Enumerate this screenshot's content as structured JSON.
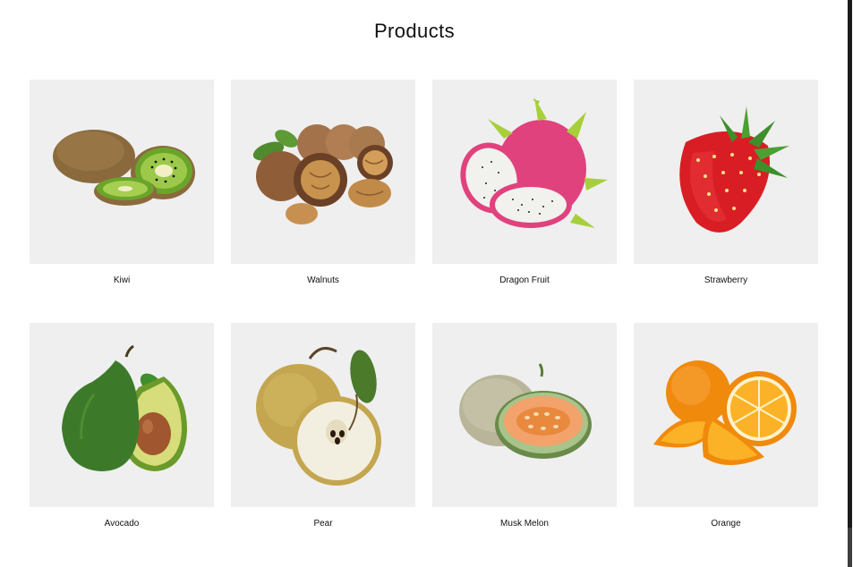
{
  "page": {
    "title": "Products"
  },
  "products": [
    {
      "name": "Kiwi",
      "image_icon": "kiwi-icon"
    },
    {
      "name": "Walnuts",
      "image_icon": "walnut-icon"
    },
    {
      "name": "Dragon Fruit",
      "image_icon": "dragon-fruit-icon"
    },
    {
      "name": "Strawberry",
      "image_icon": "strawberry-icon"
    },
    {
      "name": "Avocado",
      "image_icon": "avocado-icon"
    },
    {
      "name": "Pear",
      "image_icon": "pear-icon"
    },
    {
      "name": "Musk Melon",
      "image_icon": "musk-melon-icon"
    },
    {
      "name": "Orange",
      "image_icon": "orange-icon"
    }
  ],
  "colors": {
    "background": "#ffffff",
    "card_background": "#efefef",
    "text": "#111111"
  }
}
